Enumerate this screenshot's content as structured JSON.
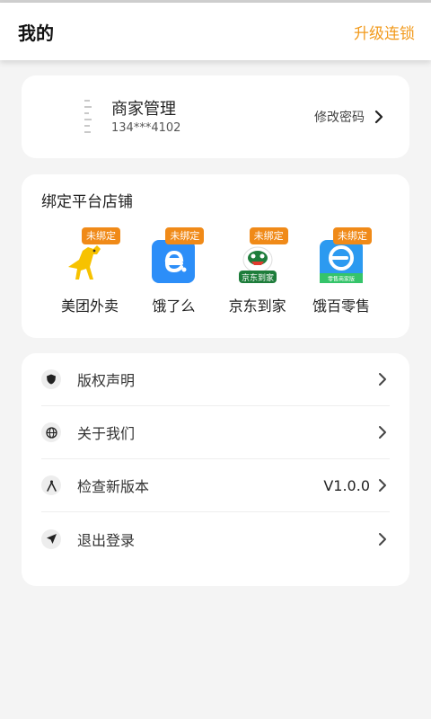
{
  "header": {
    "title": "我的",
    "upgrade_label": "升级连锁"
  },
  "profile": {
    "name": "商家管理",
    "phone": "134***4102",
    "change_password_label": "修改密码"
  },
  "bind": {
    "title": "绑定平台店铺",
    "platforms": [
      {
        "label": "美团外卖",
        "badge": "未绑定",
        "icon": "meituan-icon"
      },
      {
        "label": "饿了么",
        "badge": "未绑定",
        "icon": "eleme-icon"
      },
      {
        "label": "京东到家",
        "badge": "未绑定",
        "icon": "jddj-icon"
      },
      {
        "label": "饿百零售",
        "badge": "未绑定",
        "icon": "ebai-icon",
        "icon_text": "零售商家版"
      }
    ],
    "jd_icon_text": "京东到家"
  },
  "menu": {
    "items": [
      {
        "label": "版权声明",
        "icon": "shield-icon"
      },
      {
        "label": "关于我们",
        "icon": "globe-icon"
      },
      {
        "label": "检查新版本",
        "icon": "compass-icon",
        "value": "V1.0.0"
      },
      {
        "label": "退出登录",
        "icon": "send-icon"
      }
    ]
  },
  "colors": {
    "accent": "#f29a1c",
    "badge": "#f08a18",
    "eleme_blue": "#2c8ef8",
    "meituan_yellow": "#f7c200",
    "jd_green": "#1e7d3b"
  }
}
